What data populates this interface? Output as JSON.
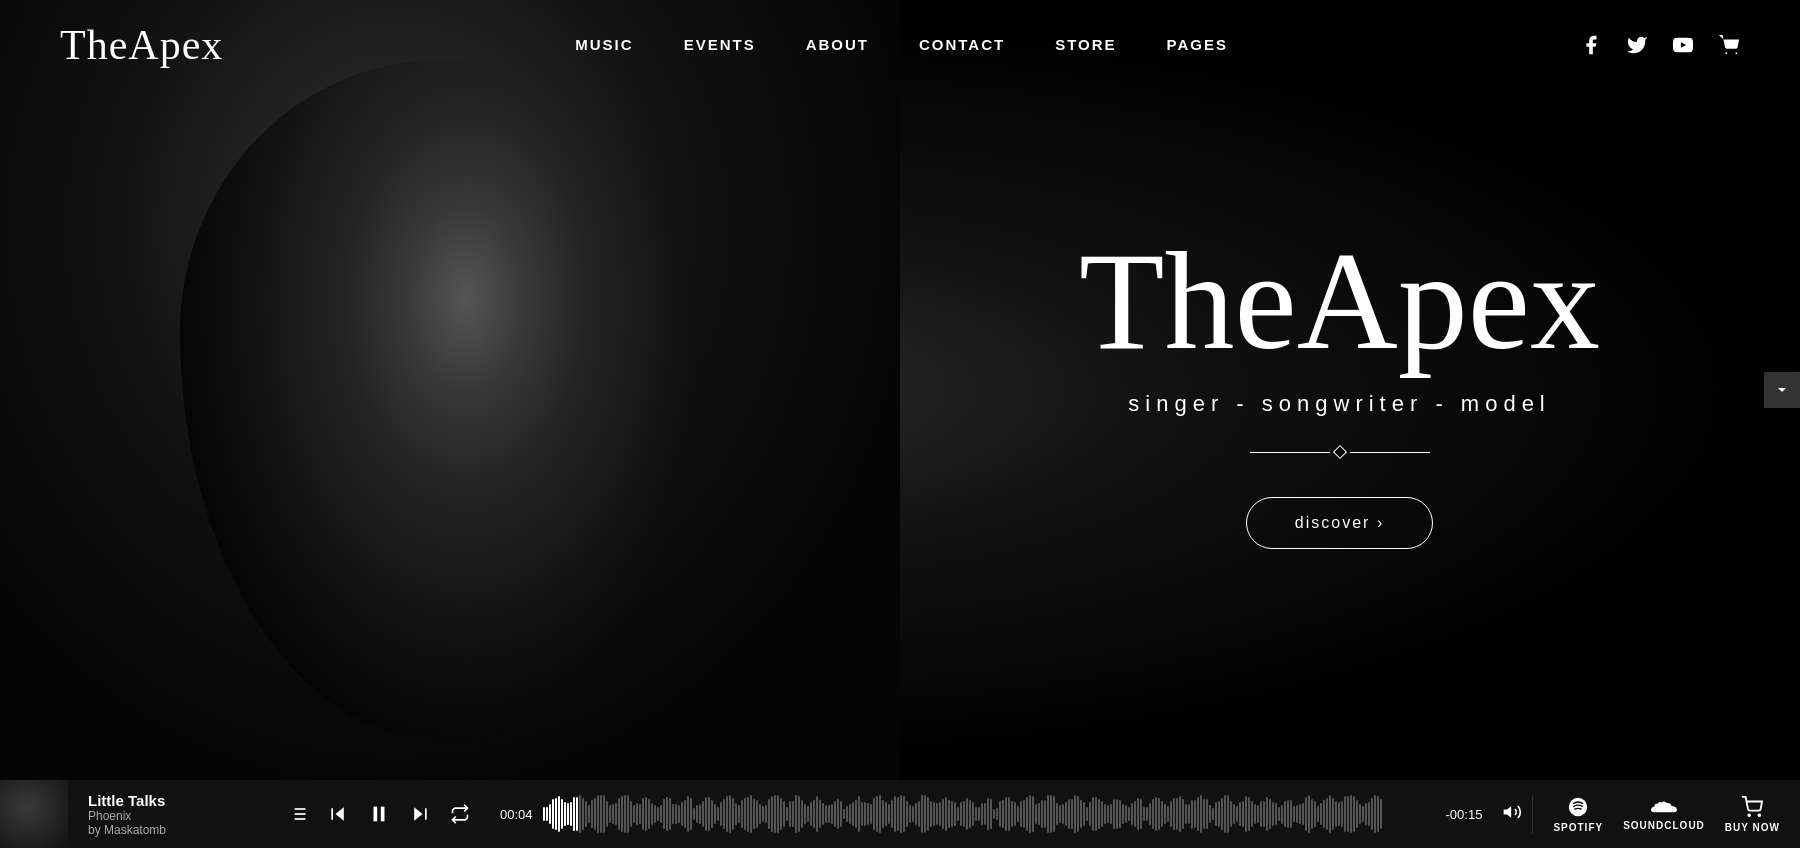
{
  "site": {
    "logo": "TheApex",
    "hero_title": "TheApex",
    "hero_subtitle": "singer - songwriter - model",
    "discover_btn": "discover  ›"
  },
  "nav": {
    "links": [
      {
        "label": "MUSIC",
        "href": "#"
      },
      {
        "label": "EVENTS",
        "href": "#"
      },
      {
        "label": "ABOUT",
        "href": "#"
      },
      {
        "label": "CONTACT",
        "href": "#"
      },
      {
        "label": "STORE",
        "href": "#"
      },
      {
        "label": "PAGES",
        "href": "#"
      }
    ]
  },
  "player": {
    "track_title": "Little Talks",
    "track_artist": "Phoenix",
    "track_by": "by Maskatomb",
    "time_current": "00:04",
    "time_remaining": "-00:15",
    "streaming_spotify": "SPOTIFY",
    "streaming_soundcloud": "SOUNDCLOUD",
    "buy_now": "BUY NOW"
  },
  "icons": {
    "facebook": "facebook-icon",
    "twitter": "twitter-icon",
    "youtube": "youtube-icon",
    "cart": "cart-icon",
    "playlist": "playlist-icon",
    "prev": "prev-icon",
    "pause": "pause-icon",
    "next": "next-icon",
    "repeat": "repeat-icon",
    "volume": "volume-icon"
  }
}
